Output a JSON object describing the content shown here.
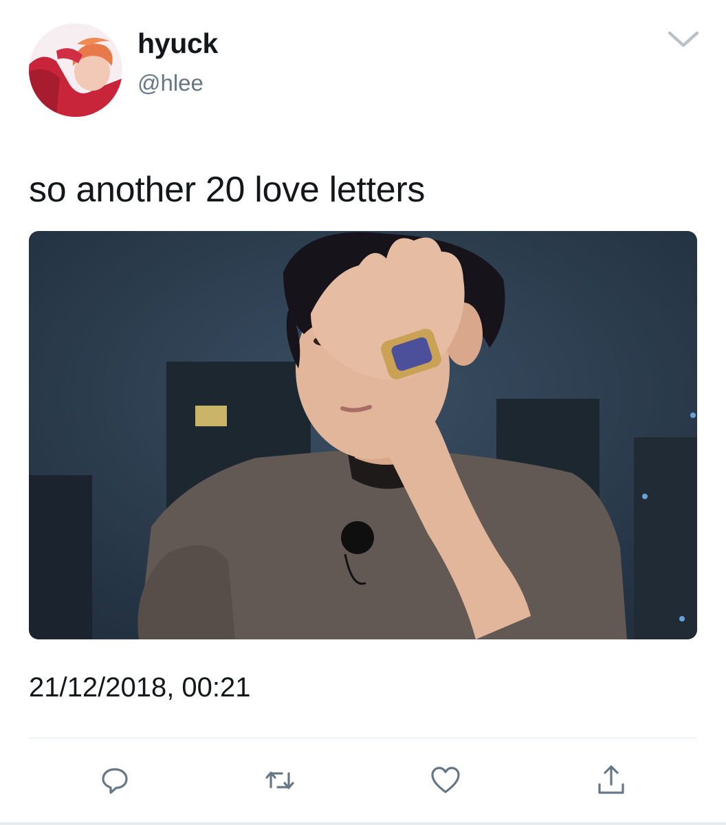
{
  "tweet": {
    "author": {
      "display_name": "hyuck",
      "handle": "@hlee"
    },
    "text": "so another 20 love letters",
    "timestamp": "21/12/2018, 00:21"
  },
  "icons": {
    "more": "chevron-down-icon",
    "reply": "reply-bubble-icon",
    "retweet": "retweet-icon",
    "like": "heart-icon",
    "share": "share-upload-icon"
  },
  "colors": {
    "text_primary": "#14171a",
    "text_secondary": "#657786",
    "icon_gray": "#657786",
    "divider": "#e1e8ed"
  }
}
